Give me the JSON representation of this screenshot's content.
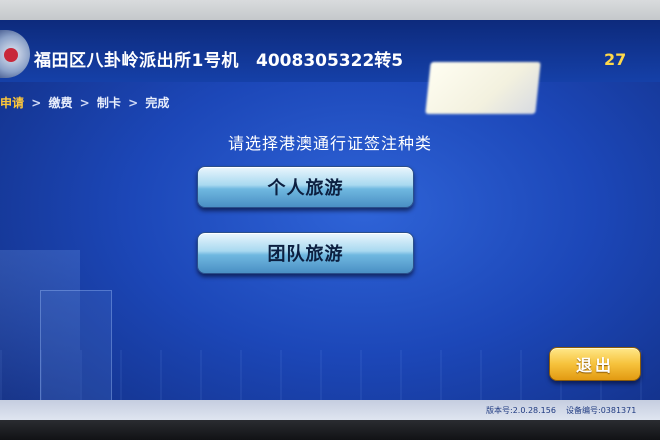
{
  "header": {
    "station_title": "福田区八卦岭派出所1号机",
    "hotline": "4008305322转5",
    "countdown": "27"
  },
  "breadcrumb": {
    "steps": [
      "申请",
      "缴费",
      "制卡",
      "完成"
    ],
    "separator": ">"
  },
  "main": {
    "prompt": "请选择港澳通行证签注种类",
    "options": [
      {
        "label": "个人旅游"
      },
      {
        "label": "团队旅游"
      }
    ],
    "exit_label": "退出"
  },
  "footer": {
    "version": "版本号:2.0.28.156",
    "device_id": "设备编号:0381371"
  },
  "colors": {
    "background": "#1c47b8",
    "header": "#0d2a7c",
    "breadcrumb_active": "#ffc83a",
    "countdown": "#ffd94a",
    "option_button": "#a9d9f0",
    "exit_button": "#f6c23c"
  },
  "icons": {
    "emblem": "police-emblem-icon"
  }
}
